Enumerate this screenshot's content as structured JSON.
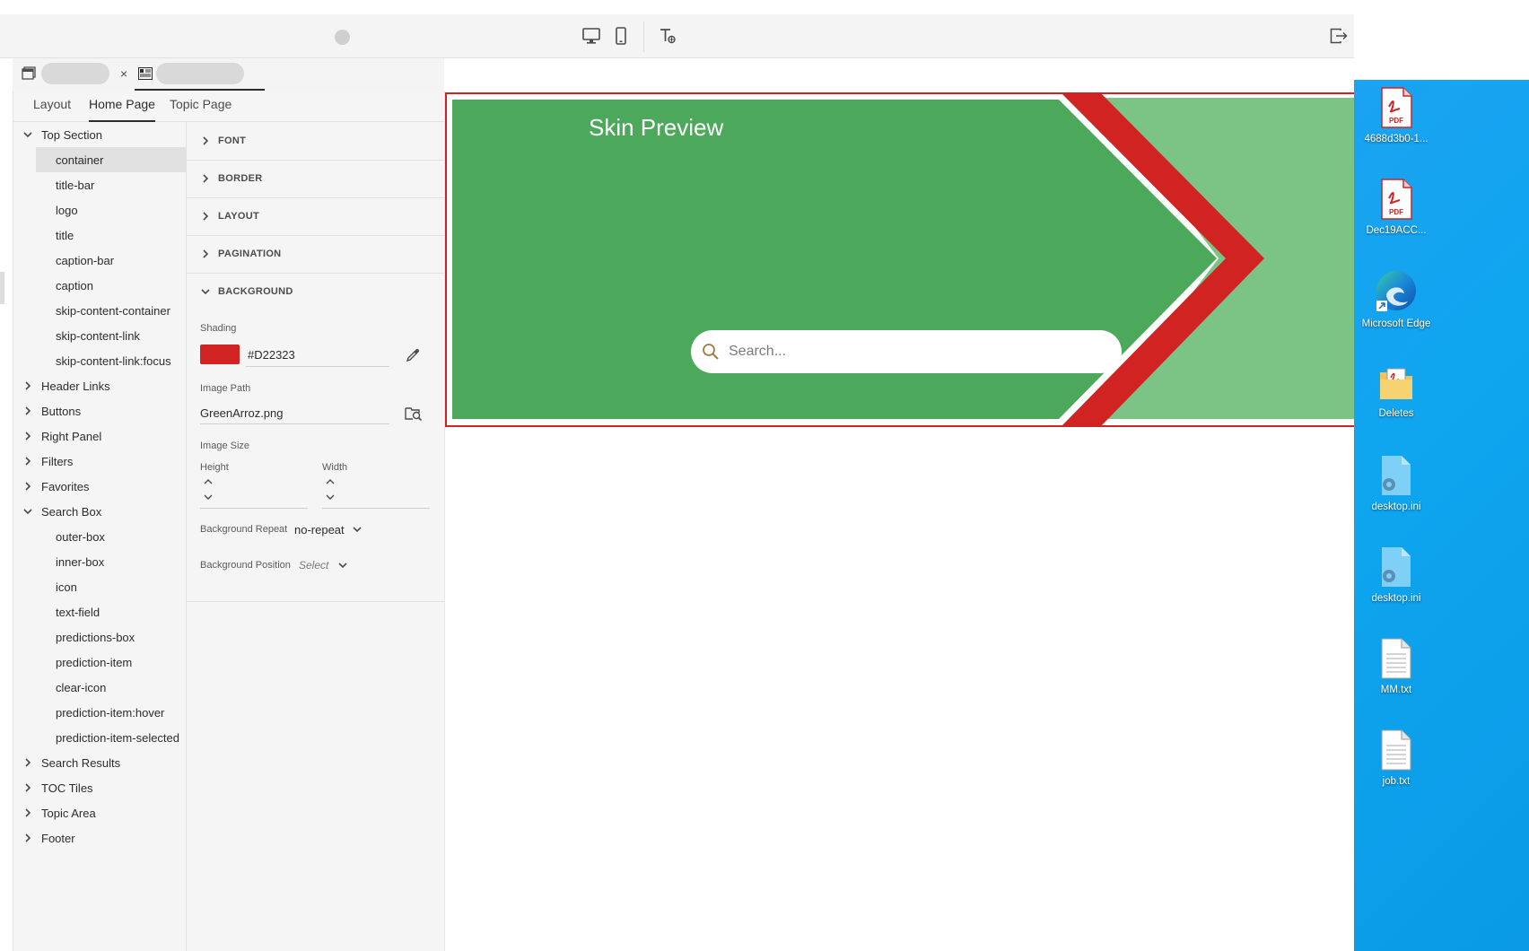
{
  "toolbar": {
    "icons": [
      "desktop-view-icon",
      "mobile-view-icon",
      "text-format-icon",
      "exit-icon"
    ]
  },
  "doc_tabs": {
    "close_symbol": "×"
  },
  "panel_tabs": [
    {
      "label": "Layout",
      "active": false
    },
    {
      "label": "Home Page",
      "active": true
    },
    {
      "label": "Topic Page",
      "active": false
    }
  ],
  "tree": {
    "top_section": "Top Section",
    "top_children": [
      "container",
      "title-bar",
      "logo",
      "title",
      "caption-bar",
      "caption",
      "skip-content-container",
      "skip-content-link",
      "skip-content-link:focus"
    ],
    "header_links": "Header Links",
    "buttons": "Buttons",
    "right_panel": "Right Panel",
    "filters": "Filters",
    "favorites": "Favorites",
    "search_box": "Search Box",
    "search_children": [
      "outer-box",
      "inner-box",
      "icon",
      "text-field",
      "predictions-box",
      "prediction-item",
      "clear-icon",
      "prediction-item:hover",
      "prediction-item-selected"
    ],
    "search_results": "Search Results",
    "toc_tiles": "TOC Tiles",
    "topic_area": "Topic Area",
    "footer": "Footer"
  },
  "props": {
    "sections": [
      "FONT",
      "BORDER",
      "LAYOUT",
      "PAGINATION",
      "BACKGROUND"
    ],
    "shading_label": "Shading",
    "shading_value": "#D22323",
    "shading_color": "#D22323",
    "image_path_label": "Image Path",
    "image_path_value": "GreenArroz.png",
    "image_size_label": "Image Size",
    "height_label": "Height",
    "width_label": "Width",
    "bg_repeat_label": "Background Repeat",
    "bg_repeat_value": "no-repeat",
    "bg_position_label": "Background Position",
    "bg_position_value": "Select"
  },
  "preview": {
    "title": "Skin Preview",
    "search_placeholder": "Search...",
    "green_dark": "#4CA85A",
    "green_light": "#7BC485",
    "red": "#D22323"
  },
  "desktop": {
    "icons": [
      {
        "label": "4688d3b0-1...",
        "type": "pdf"
      },
      {
        "label": "Dec19ACC...",
        "type": "pdf"
      },
      {
        "label": "Microsoft Edge",
        "type": "edge"
      },
      {
        "label": "Deletes",
        "type": "folder"
      },
      {
        "label": "desktop.ini",
        "type": "ini"
      },
      {
        "label": "desktop.ini",
        "type": "ini"
      },
      {
        "label": "MM.txt",
        "type": "txt"
      },
      {
        "label": "job.txt",
        "type": "txt"
      }
    ]
  }
}
